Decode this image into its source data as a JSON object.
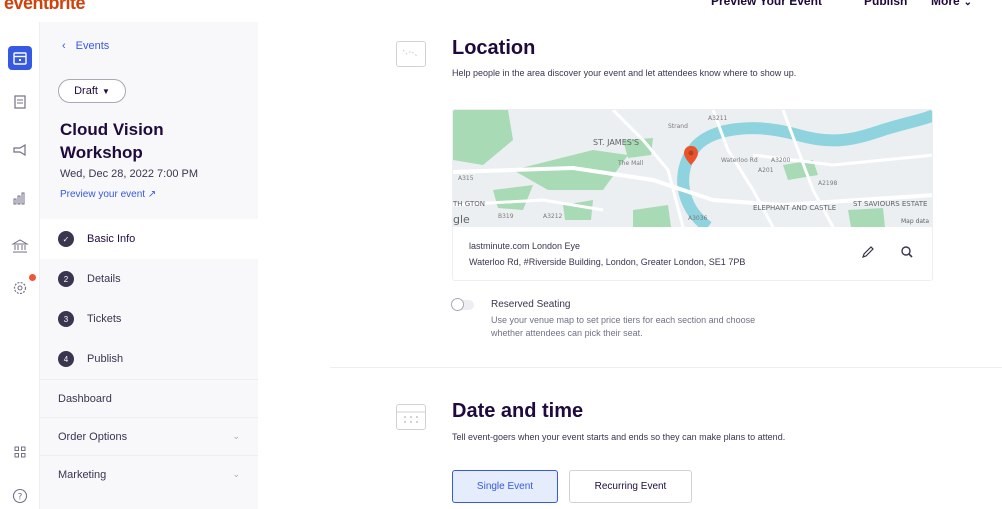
{
  "topbar": {
    "logo": "eventbrite",
    "preview": "Preview Your Event",
    "publish": "Publish",
    "more": "More"
  },
  "sidebar": {
    "back": "Events",
    "status": "Draft",
    "event_title": "Cloud Vision Workshop",
    "event_date": "Wed, Dec 28, 2022 7:00 PM",
    "preview_link": "Preview your event",
    "steps": [
      {
        "num": "✓",
        "label": "Basic Info"
      },
      {
        "num": "2",
        "label": "Details"
      },
      {
        "num": "3",
        "label": "Tickets"
      },
      {
        "num": "4",
        "label": "Publish"
      }
    ],
    "nav": [
      {
        "label": "Dashboard"
      },
      {
        "label": "Order Options"
      },
      {
        "label": "Marketing"
      }
    ]
  },
  "location": {
    "title": "Location",
    "description": "Help people in the area discover your event and let attendees know where to show up.",
    "venue_name": "lastminute.com London Eye",
    "venue_address": "Waterloo Rd, #Riverside Building, London, Greater London, SE1 7PB",
    "map_labels": [
      "ST. JAMES'S",
      "ELEPHANT AND CASTLE",
      "ST SAVIOURS ESTATE",
      "A3200",
      "A315",
      "A3212",
      "A3036",
      "A2198",
      "A3211",
      "B319",
      "A201",
      "Waterloo Rd",
      "The Mall",
      "Strand",
      "Map data",
      "gle",
      "TH GTON"
    ]
  },
  "seating": {
    "title": "Reserved Seating",
    "description": "Use your venue map to set price tiers for each section and choose whether attendees can pick their seat."
  },
  "datetime": {
    "title": "Date and time",
    "description": "Tell event-goers when your event starts and ends so they can make plans to attend.",
    "single": "Single Event",
    "recurring": "Recurring Event"
  },
  "colors": {
    "accent": "#3659e3",
    "brand": "#d1410c",
    "river": "#8fd3df",
    "park": "#a8dab5",
    "pin": "#e8542c"
  }
}
